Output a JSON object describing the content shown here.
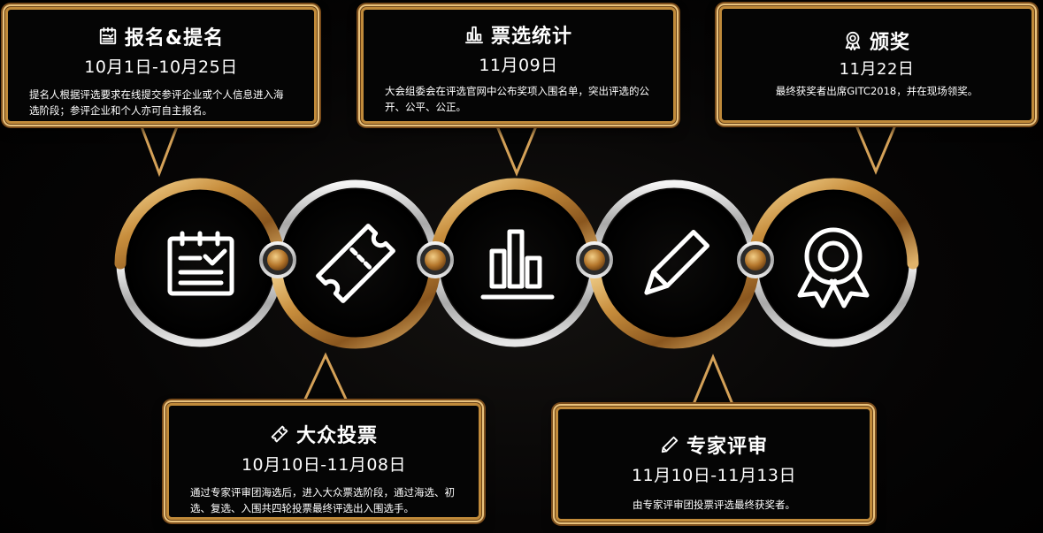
{
  "stages": [
    {
      "id": "registration",
      "icon": "clipboard-check-icon",
      "title": "报名&提名",
      "date": "10月1日-10月25日",
      "desc": "提名人根据评选要求在线提交参评企业或个人信息进入海选阶段；参评企业和个人亦可自主报名。"
    },
    {
      "id": "public-vote",
      "icon": "ticket-icon",
      "title": "大众投票",
      "date": "10月10日-11月08日",
      "desc": "通过专家评审团海选后，进入大众票选阶段，通过海选、初选、复选、入围共四轮投票最终评选出入围选手。"
    },
    {
      "id": "vote-stats",
      "icon": "bar-chart-icon",
      "title": "票选统计",
      "date": "11月09日",
      "desc": "大会组委会在评选官网中公布奖项入围名单，突出评选的公开、公平、公正。"
    },
    {
      "id": "expert-review",
      "icon": "pencil-icon",
      "title": "专家评审",
      "date": "11月10日-11月13日",
      "desc": "由专家评审团投票评选最终获奖者。"
    },
    {
      "id": "award",
      "icon": "award-badge-icon",
      "title": "颁奖",
      "date": "11月22日",
      "desc": "最终获奖者出席GITC2018，并在现场领奖。"
    }
  ],
  "colors": {
    "gold": "#c9913f",
    "gold_light": "#f1cf8c",
    "gold_dark": "#6e4416",
    "silver": "#b9b9b9",
    "silver_light": "#f2f2f2",
    "background": "#000000",
    "text": "#ffffff"
  }
}
